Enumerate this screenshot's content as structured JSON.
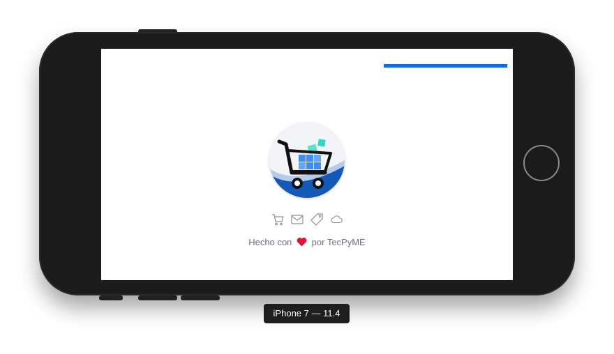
{
  "device": {
    "label": "iPhone 7 — 11.4"
  },
  "screen": {
    "progress": {
      "value_fraction": 0.3,
      "color": "#0a6cf0"
    },
    "logo": {
      "icon": "shopping-cart-logo"
    },
    "feature_icons": [
      "cart-icon",
      "mail-icon",
      "tag-icon",
      "cloud-icon"
    ],
    "footer": {
      "prefix": "Hecho con",
      "heart_icon": "heart-icon",
      "heart_color": "#e5123c",
      "suffix": "por TecPyME"
    }
  }
}
